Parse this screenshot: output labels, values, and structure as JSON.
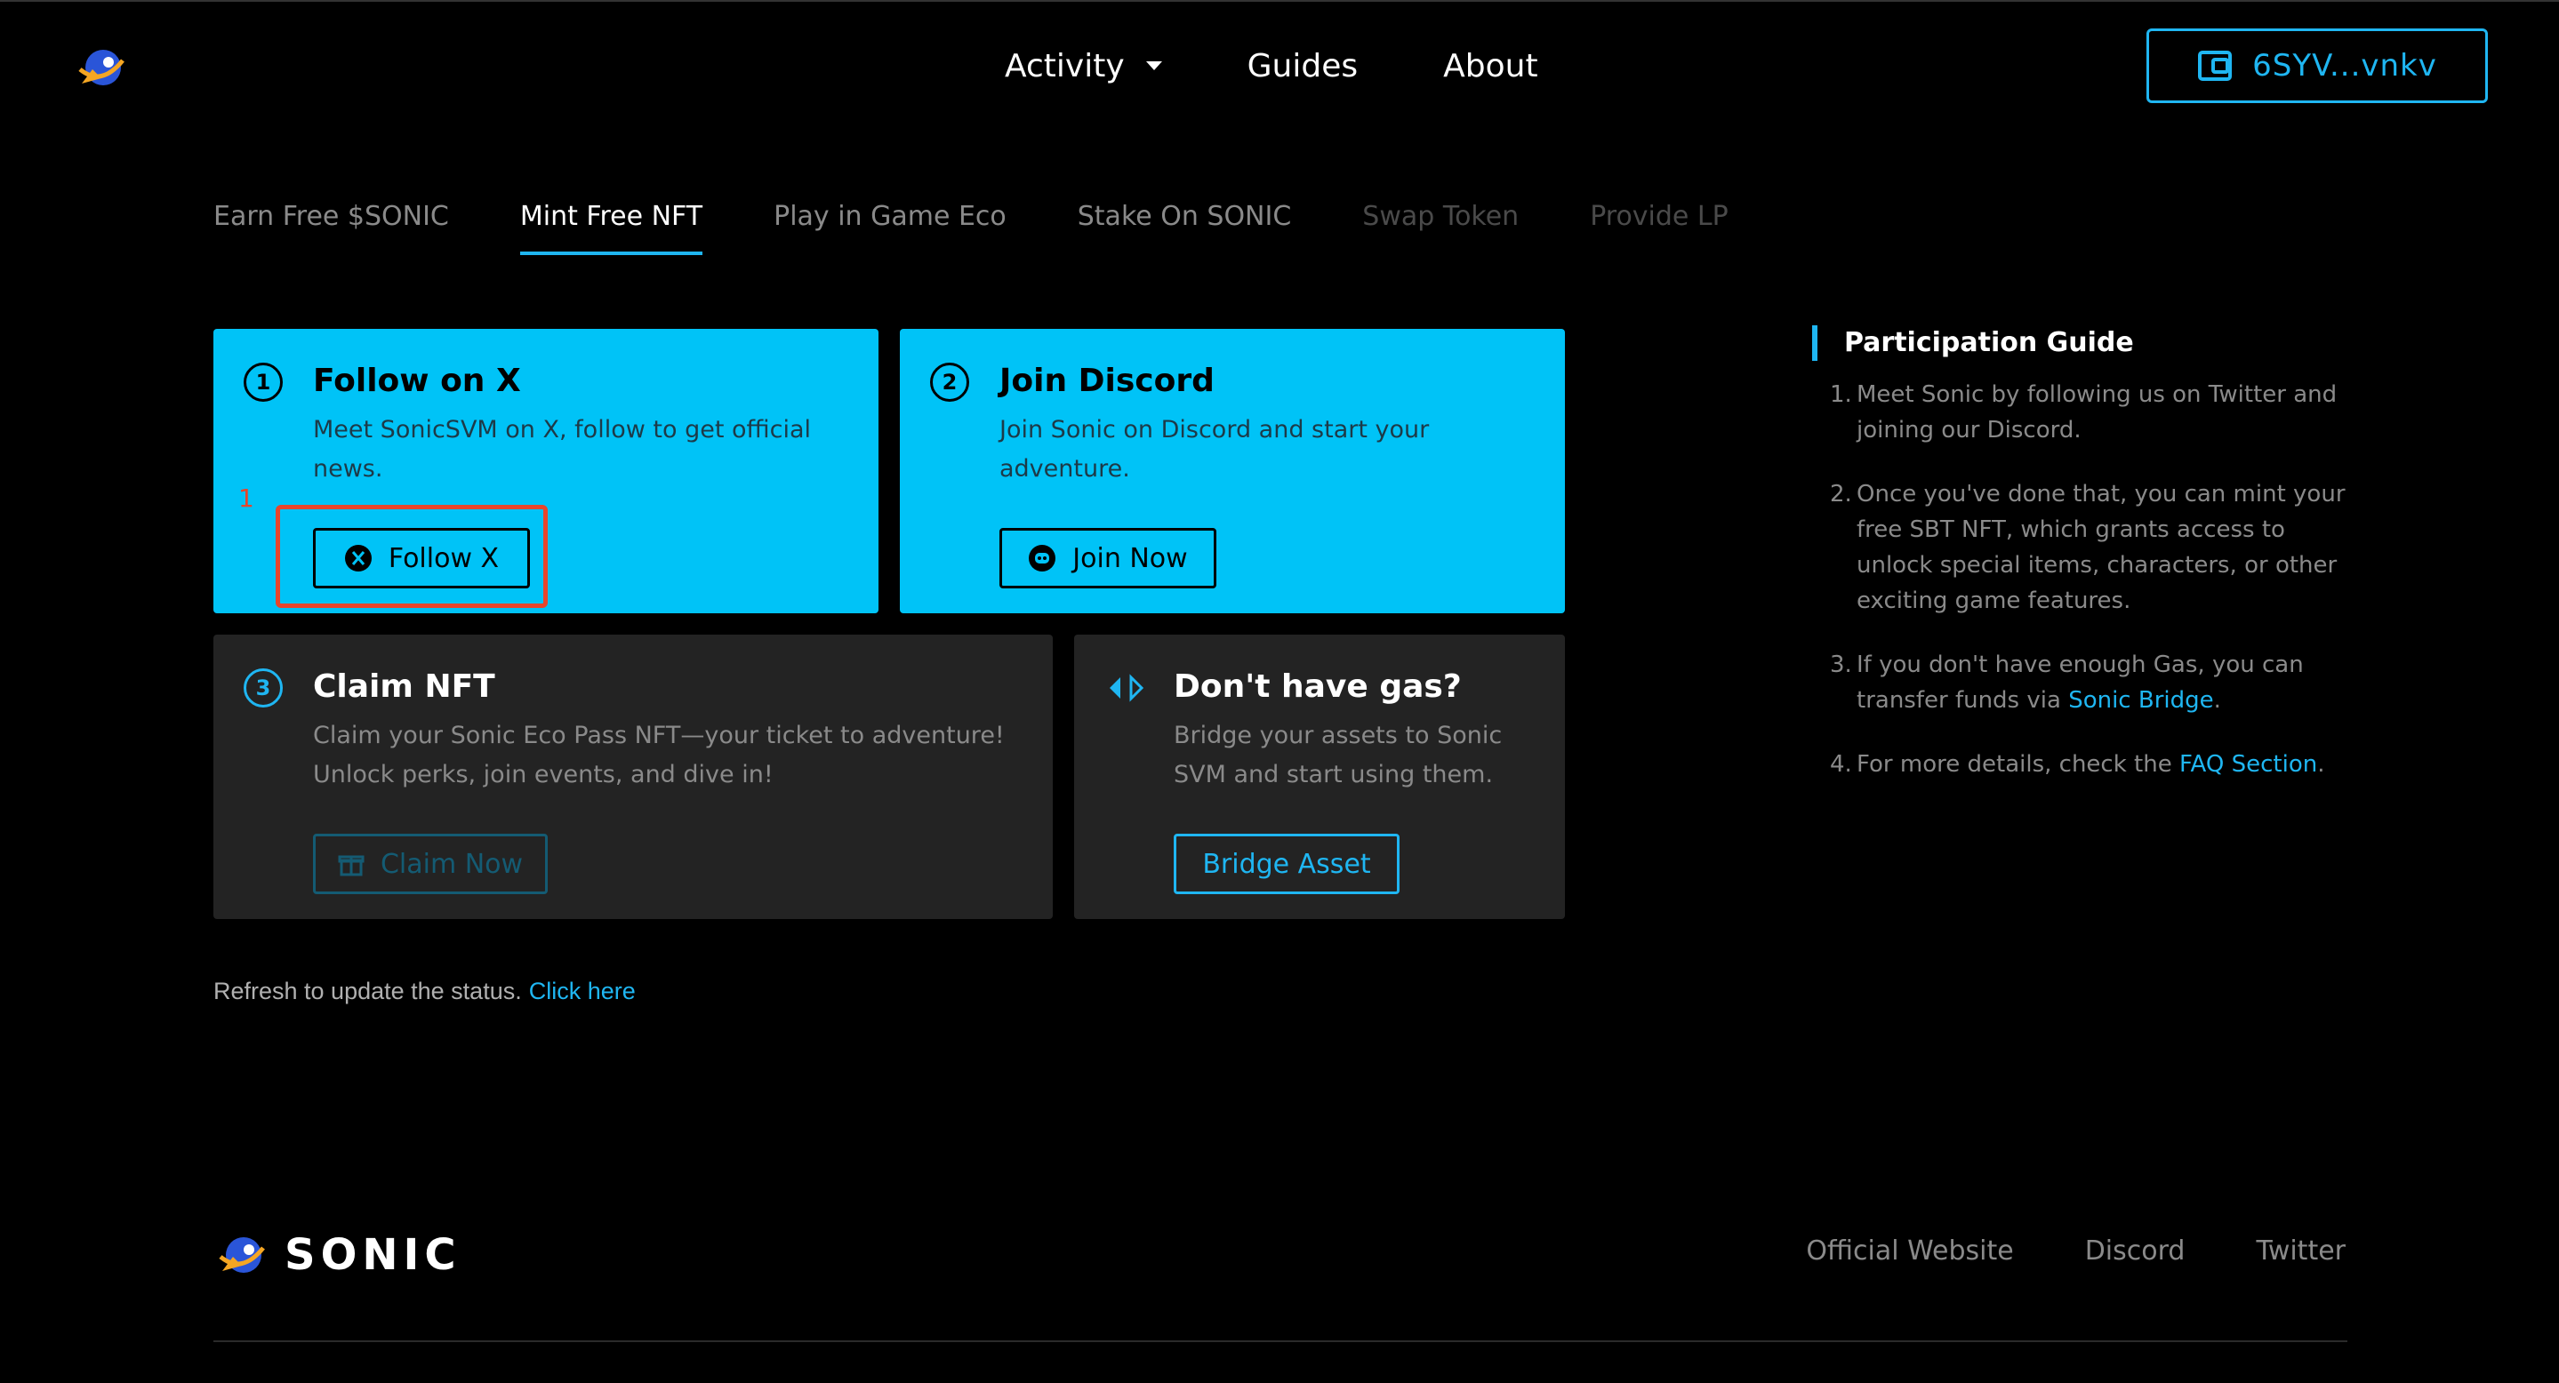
{
  "header": {
    "nav": [
      {
        "label": "Activity",
        "dropdown": true
      },
      {
        "label": "Guides",
        "dropdown": false
      },
      {
        "label": "About",
        "dropdown": false
      }
    ],
    "wallet_label": "6SYV...vnkv"
  },
  "tabs": [
    {
      "label": "Earn Free $SONIC",
      "state": "normal"
    },
    {
      "label": "Mint Free NFT",
      "state": "active"
    },
    {
      "label": "Play in Game Eco",
      "state": "normal"
    },
    {
      "label": "Stake On SONIC",
      "state": "normal"
    },
    {
      "label": "Swap Token",
      "state": "disabled"
    },
    {
      "label": "Provide LP",
      "state": "disabled"
    }
  ],
  "cards": {
    "follow": {
      "num": "1",
      "title": "Follow on X",
      "desc_line1": "Meet SonicSVM on X, follow to get official",
      "desc_line2": "news.",
      "button": "Follow X"
    },
    "discord": {
      "num": "2",
      "title": "Join Discord",
      "desc_line1": "Join Sonic on Discord and start your",
      "desc_line2": "adventure.",
      "button": "Join Now"
    },
    "claim": {
      "num": "3",
      "title": "Claim NFT",
      "desc_line1": "Claim your Sonic Eco Pass NFT—your ticket to adventure!",
      "desc_line2": "Unlock perks, join events, and dive in!",
      "button": "Claim Now"
    },
    "gas": {
      "title": "Don't have gas?",
      "desc_line1": "Bridge your assets to Sonic",
      "desc_line2": "SVM and start using them.",
      "button": "Bridge Asset"
    }
  },
  "annotation": {
    "number": "1"
  },
  "refresh": {
    "text": "Refresh to update the status.",
    "link": "Click here"
  },
  "guide": {
    "title": "Participation Guide",
    "items": [
      {
        "idx": "1.",
        "text": "Meet Sonic by following us on Twitter and joining our Discord."
      },
      {
        "idx": "2.",
        "text": "Once you've done that, you can mint your free SBT NFT, which grants access to unlock special items, characters, or other exciting game features."
      },
      {
        "idx": "3.",
        "text_before": "If you don't have enough Gas, you can transfer funds via ",
        "link": "Sonic Bridge",
        "text_after": "."
      },
      {
        "idx": "4.",
        "text_before": "For more details, check the ",
        "link": "FAQ Section",
        "text_after": "."
      }
    ]
  },
  "footer": {
    "brand": "SONIC",
    "links": [
      "Official Website",
      "Discord",
      "Twitter"
    ]
  },
  "colors": {
    "accent": "#00c3f7",
    "link": "#1fb6f2",
    "highlight": "#e8452b",
    "card_dark": "#232323"
  }
}
